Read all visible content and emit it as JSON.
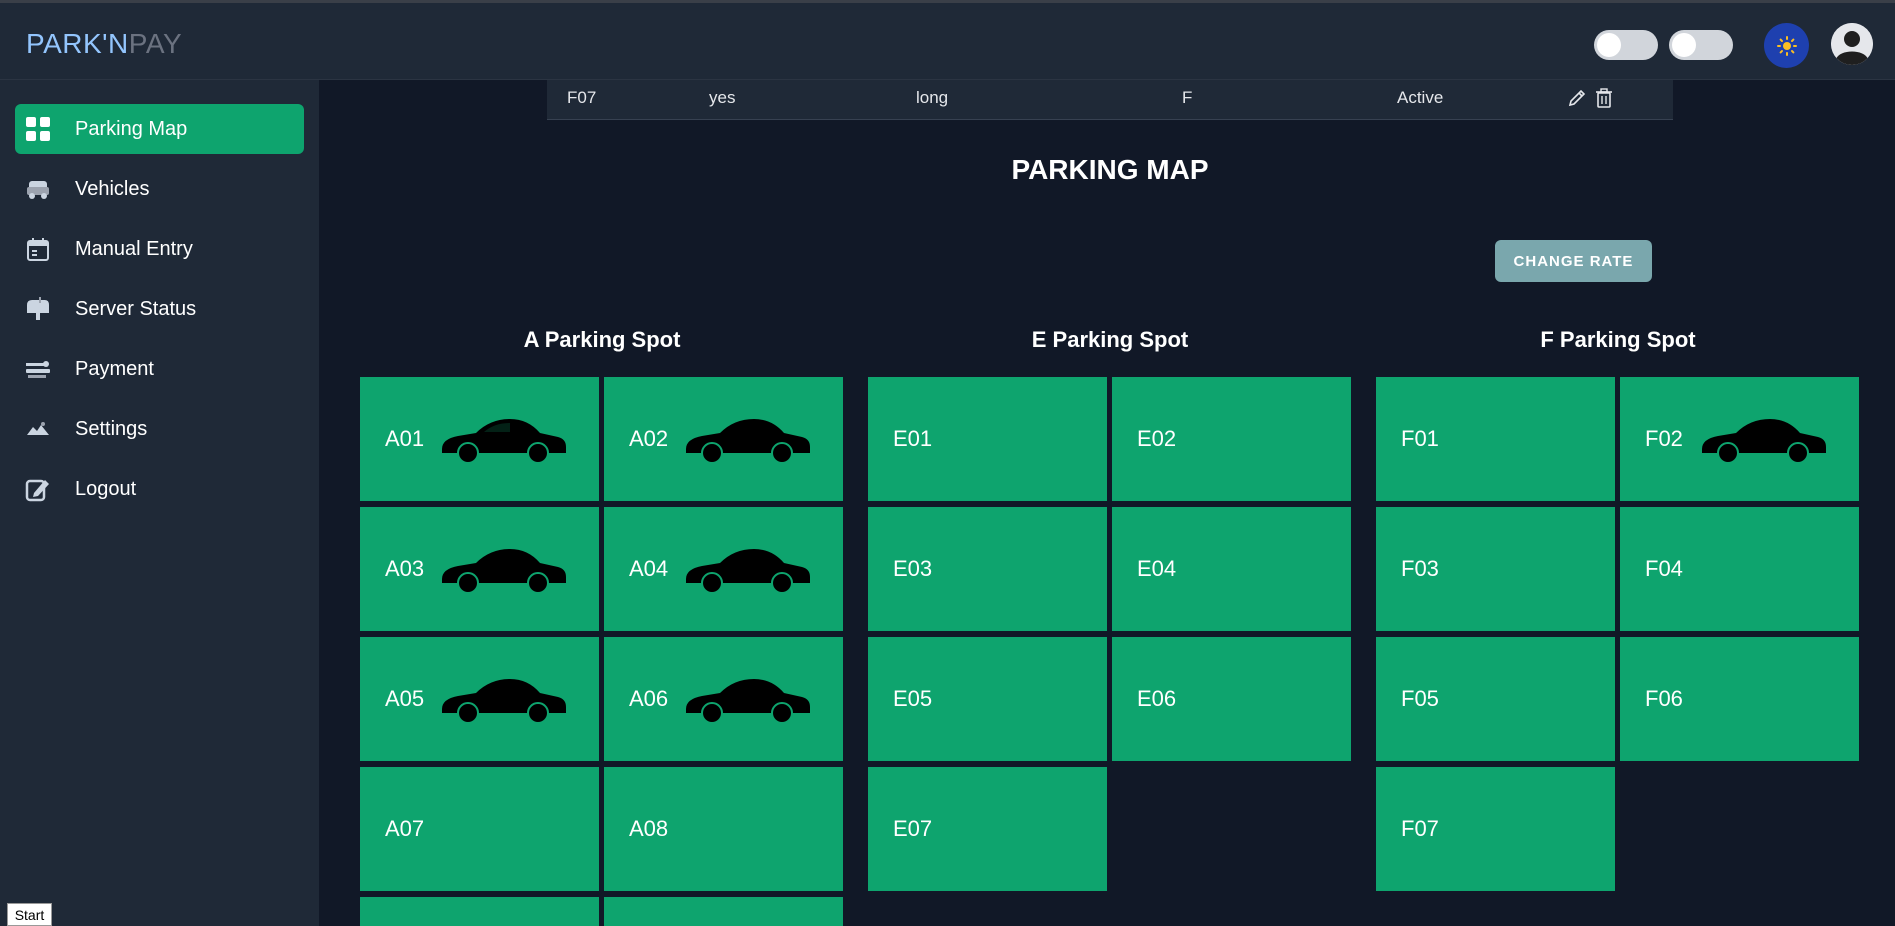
{
  "brand": {
    "part1": "PARK'N",
    "part2": "PAY"
  },
  "colors": {
    "accent": "#0ea46e",
    "bg": "#111827",
    "panel": "#1f2937",
    "rate_button": "#7aa7ad"
  },
  "header": {
    "toggles": [
      {
        "name": "toggle-1"
      },
      {
        "name": "toggle-2"
      }
    ],
    "theme_icon": "sun-icon",
    "avatar_icon": "user-avatar-icon"
  },
  "sidebar": {
    "items": [
      {
        "label": "Parking Map",
        "icon": "grid-icon",
        "active": true
      },
      {
        "label": "Vehicles",
        "icon": "vehicle-icon",
        "active": false
      },
      {
        "label": "Manual Entry",
        "icon": "calendar-icon",
        "active": false
      },
      {
        "label": "Server Status",
        "icon": "mailbox-icon",
        "active": false
      },
      {
        "label": "Payment",
        "icon": "payment-icon",
        "active": false
      },
      {
        "label": "Settings",
        "icon": "settings-icon",
        "active": false
      },
      {
        "label": "Logout",
        "icon": "logout-icon",
        "active": false
      }
    ]
  },
  "table_row": {
    "spot": "F07",
    "flag": "yes",
    "duration": "long",
    "lot": "F",
    "status": "Active"
  },
  "main": {
    "title": "PARKING MAP",
    "change_rate_label": "CHANGE RATE",
    "lots": [
      {
        "title": "A Parking Spot",
        "spots": [
          {
            "label": "A01",
            "occupied": true
          },
          {
            "label": "A02",
            "occupied": true
          },
          {
            "label": "A03",
            "occupied": true
          },
          {
            "label": "A04",
            "occupied": true
          },
          {
            "label": "A05",
            "occupied": true
          },
          {
            "label": "A06",
            "occupied": true
          },
          {
            "label": "A07",
            "occupied": false
          },
          {
            "label": "A08",
            "occupied": false
          }
        ]
      },
      {
        "title": "E Parking Spot",
        "spots": [
          {
            "label": "E01",
            "occupied": false
          },
          {
            "label": "E02",
            "occupied": false
          },
          {
            "label": "E03",
            "occupied": false
          },
          {
            "label": "E04",
            "occupied": false
          },
          {
            "label": "E05",
            "occupied": false
          },
          {
            "label": "E06",
            "occupied": false
          },
          {
            "label": "E07",
            "occupied": false
          }
        ]
      },
      {
        "title": "F Parking Spot",
        "spots": [
          {
            "label": "F01",
            "occupied": false
          },
          {
            "label": "F02",
            "occupied": true
          },
          {
            "label": "F03",
            "occupied": false
          },
          {
            "label": "F04",
            "occupied": false
          },
          {
            "label": "F05",
            "occupied": false
          },
          {
            "label": "F06",
            "occupied": false
          },
          {
            "label": "F07",
            "occupied": false
          }
        ]
      }
    ]
  },
  "status_bar": {
    "start_label": "Start"
  }
}
